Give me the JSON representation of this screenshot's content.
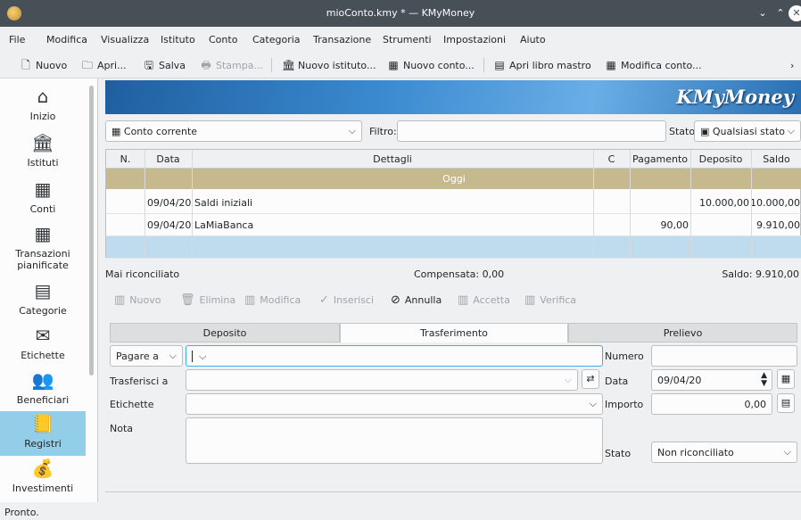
{
  "window": {
    "title": "mioConto.kmy * — KMyMoney",
    "minimize": "⌄",
    "maximize": "⌃",
    "close": "✕"
  },
  "menu": [
    "File",
    "Modifica",
    "Visualizza",
    "Istituto",
    "Conto",
    "Categoria",
    "Transazione",
    "Strumenti",
    "Impostazioni",
    "Aiuto"
  ],
  "toolbar": {
    "nuovo": "Nuovo",
    "apri": "Apri...",
    "salva": "Salva",
    "stampa": "Stampa...",
    "nuovo_istituto": "Nuovo istituto...",
    "nuovo_conto": "Nuovo conto...",
    "apri_libro": "Apri libro mastro",
    "modifica_conto": "Modifica conto...",
    "overflow": "›"
  },
  "sidebar": [
    {
      "label": "Inizio",
      "icon": "⌂"
    },
    {
      "label": "Istituti",
      "icon": "🏛"
    },
    {
      "label": "Conti",
      "icon": "▦"
    },
    {
      "label": "Transazioni pianificate",
      "icon": "▦"
    },
    {
      "label": "Categorie",
      "icon": "▤"
    },
    {
      "label": "Etichette",
      "icon": "✉"
    },
    {
      "label": "Beneficiari",
      "icon": "👥"
    },
    {
      "label": "Registri",
      "icon": "📒"
    },
    {
      "label": "Investimenti",
      "icon": "💰"
    }
  ],
  "banner": {
    "logo": "KMyMoney"
  },
  "filter": {
    "account": "Conto corrente",
    "filter_label": "Filtro:",
    "filter_value": "",
    "state_label": "Stato",
    "state_value": "Qualsiasi stato"
  },
  "ledger": {
    "columns": [
      "N.",
      "Data",
      "Dettagli",
      "C",
      "Pagamento",
      "Deposito",
      "Saldo"
    ],
    "group": "Oggi",
    "rows": [
      {
        "n": "",
        "date": "09/04/20",
        "details": "Saldi iniziali",
        "c": "",
        "payment": "",
        "deposit": "10.000,00",
        "balance": "10.000,00"
      },
      {
        "n": "",
        "date": "09/04/20",
        "details": "LaMiaBanca",
        "c": "",
        "payment": "90,00",
        "deposit": "",
        "balance": "9.910,00"
      }
    ]
  },
  "summary": {
    "unreconciled": "Mai riconciliato",
    "cleared": "Compensata: 0,00",
    "balance": "Saldo: 9.910,00"
  },
  "actions": {
    "nuovo": "Nuovo",
    "elimina": "Elimina",
    "modifica": "Modifica",
    "inserisci": "Inserisci",
    "annulla": "Annulla",
    "accetta": "Accetta",
    "verifica": "Verifica"
  },
  "form": {
    "tabs": [
      "Deposito",
      "Trasferimento",
      "Prelievo"
    ],
    "active_tab": "Trasferimento",
    "payee_mode": "Pagare a",
    "payee_value": "",
    "transfer_label": "Trasferisci a",
    "tags_label": "Etichette",
    "memo_label": "Nota",
    "number_label": "Numero",
    "number_value": "",
    "date_label": "Data",
    "date_value": "09/04/20",
    "amount_label": "Importo",
    "amount_value": "0,00",
    "state_label": "Stato",
    "state_value": "Non riconciliato"
  },
  "statusbar": "Pronto."
}
